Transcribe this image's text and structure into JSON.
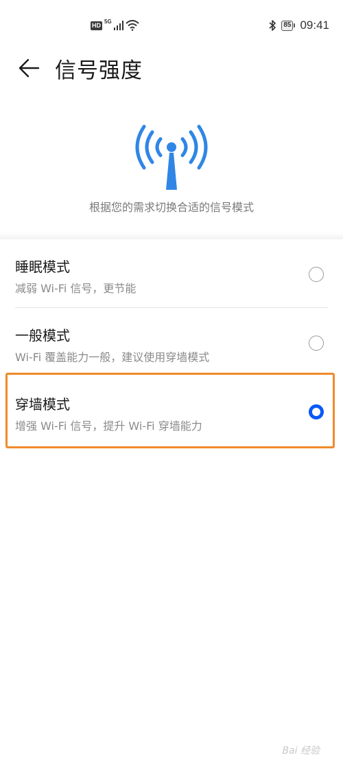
{
  "status_bar": {
    "hd": "HD",
    "network": "5G",
    "battery": "85",
    "time": "09:41"
  },
  "header": {
    "title": "信号强度"
  },
  "hero": {
    "description": "根据您的需求切换合适的信号模式"
  },
  "options": [
    {
      "title": "睡眠模式",
      "subtitle": "减弱 Wi-Fi 信号，更节能",
      "selected": false
    },
    {
      "title": "一般模式",
      "subtitle": "Wi-Fi 覆盖能力一般，建议使用穿墙模式",
      "selected": false
    },
    {
      "title": "穿墙模式",
      "subtitle": "增强 Wi-Fi 信号，提升 Wi-Fi 穿墙能力",
      "selected": true
    }
  ],
  "colors": {
    "accent": "#0a59f7",
    "hero_icon": "#2f86e6",
    "highlight": "#f08a2c"
  },
  "icons": {
    "back": "arrow-left-icon",
    "hero": "antenna-signal-icon"
  },
  "watermark": "Bai 经验"
}
